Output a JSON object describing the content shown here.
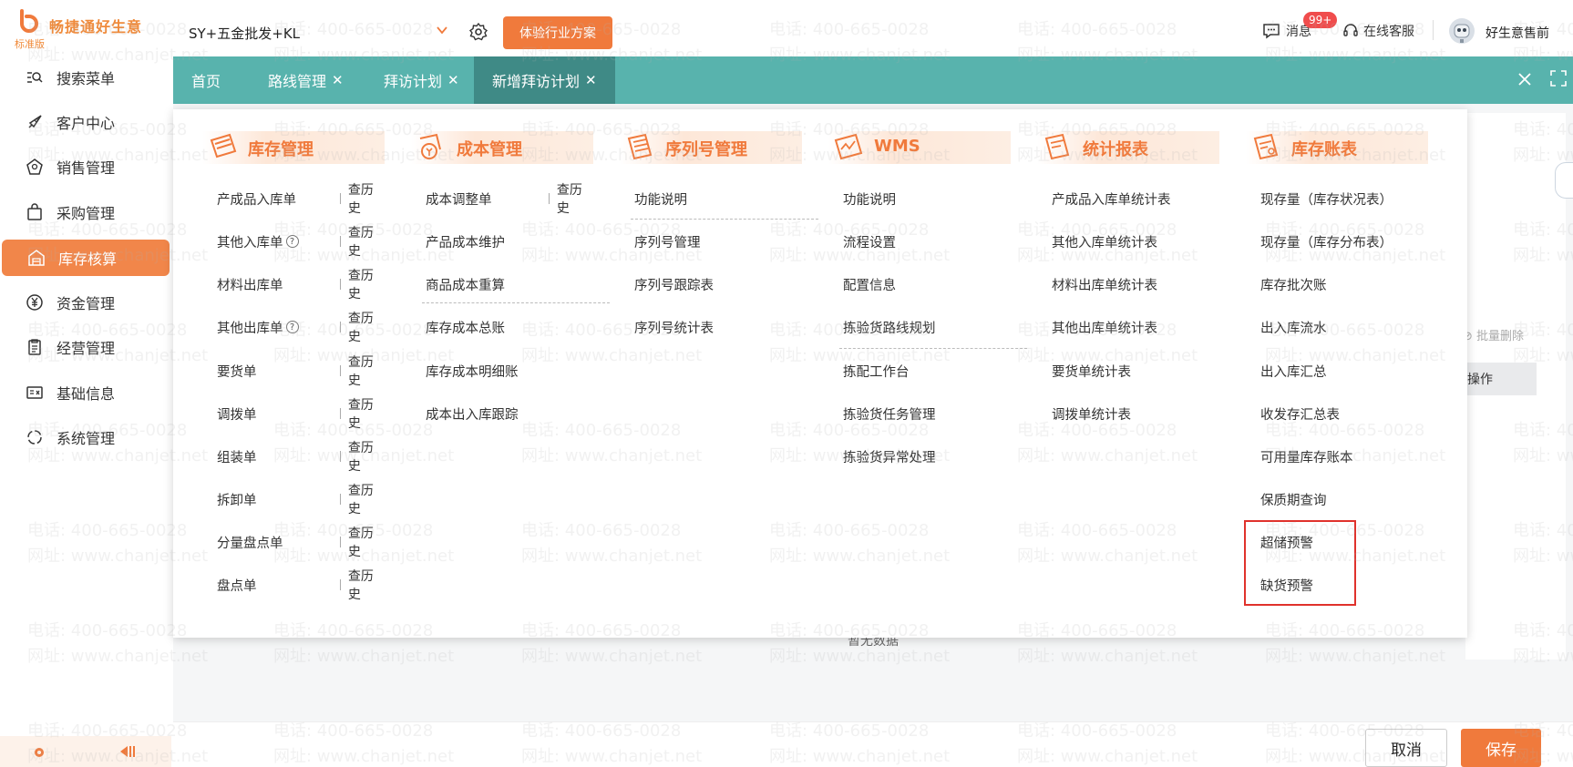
{
  "header": {
    "brand": "畅捷通好生意",
    "edition": "标准版",
    "company": "SY+五金批发+KL",
    "trial_button": "体验行业方案",
    "messages_label": "消息",
    "messages_badge": "99+",
    "service_label": "在线客服",
    "username": "好生意售前"
  },
  "sidebar": {
    "items": [
      {
        "label": "搜索菜单",
        "icon": "search-menu-icon"
      },
      {
        "label": "客户中心",
        "icon": "rocket-icon"
      },
      {
        "label": "销售管理",
        "icon": "sales-icon"
      },
      {
        "label": "采购管理",
        "icon": "bag-icon"
      },
      {
        "label": "库存核算",
        "icon": "warehouse-icon",
        "active": true
      },
      {
        "label": "资金管理",
        "icon": "yen-icon"
      },
      {
        "label": "经营管理",
        "icon": "clipboard-icon"
      },
      {
        "label": "基础信息",
        "icon": "info-card-icon"
      },
      {
        "label": "系统管理",
        "icon": "system-icon"
      }
    ]
  },
  "tabs": [
    {
      "label": "首页",
      "closable": false
    },
    {
      "label": "路线管理",
      "closable": true
    },
    {
      "label": "拜访计划",
      "closable": true
    },
    {
      "label": "新增拜访计划",
      "closable": true,
      "active": true
    }
  ],
  "menu": {
    "history_label": "查历史",
    "columns": [
      {
        "title": "库存管理",
        "icon": "inventory-icon",
        "items": [
          "产成品入库单",
          "其他入库单",
          "材料出库单",
          "其他出库单",
          "要货单",
          "调拨单",
          "组装单",
          "拆卸单",
          "分量盘点单",
          "盘点单"
        ]
      },
      {
        "title": "成本管理",
        "icon": "cost-icon",
        "items": [
          "成本调整单",
          "产品成本维护",
          "商品成本重算",
          "库存成本总账",
          "库存成本明细账",
          "成本出入库跟踪"
        ]
      },
      {
        "title": "序列号管理",
        "icon": "serial-icon",
        "items": [
          "功能说明",
          "序列号管理",
          "序列号跟踪表",
          "序列号统计表"
        ]
      },
      {
        "title": "WMS",
        "icon": "wms-icon",
        "items": [
          "功能说明",
          "流程设置",
          "配置信息",
          "拣验货路线规划",
          "拣配工作台",
          "拣验货任务管理",
          "拣验货异常处理"
        ]
      },
      {
        "title": "统计报表",
        "icon": "report-icon",
        "items": [
          "产成品入库单统计表",
          "其他入库单统计表",
          "材料出库单统计表",
          "其他出库单统计表",
          "要货单统计表",
          "调拨单统计表"
        ]
      },
      {
        "title": "库存账表",
        "icon": "ledger-icon",
        "items": [
          "现存量（库存状况表）",
          "现存量（库存分布表）",
          "库存批次账",
          "出入库流水",
          "出入库汇总",
          "收发存汇总表",
          "可用量库存账本",
          "保质期查询",
          "超储预警",
          "缺货预警"
        ]
      }
    ]
  },
  "background": {
    "batch_delete": "批量删除",
    "operation_header": "操作",
    "no_data": "暂无数据",
    "cancel_button": "取消",
    "save_button": "保存"
  },
  "watermark": {
    "phone": "电话: 400-665-0028",
    "site": "网址: www.chanjet.net"
  },
  "colors": {
    "accent": "#f07a3c",
    "tabbar": "#58b3ad",
    "tab_active": "#3f8a86",
    "highlight": "#e0322c"
  }
}
